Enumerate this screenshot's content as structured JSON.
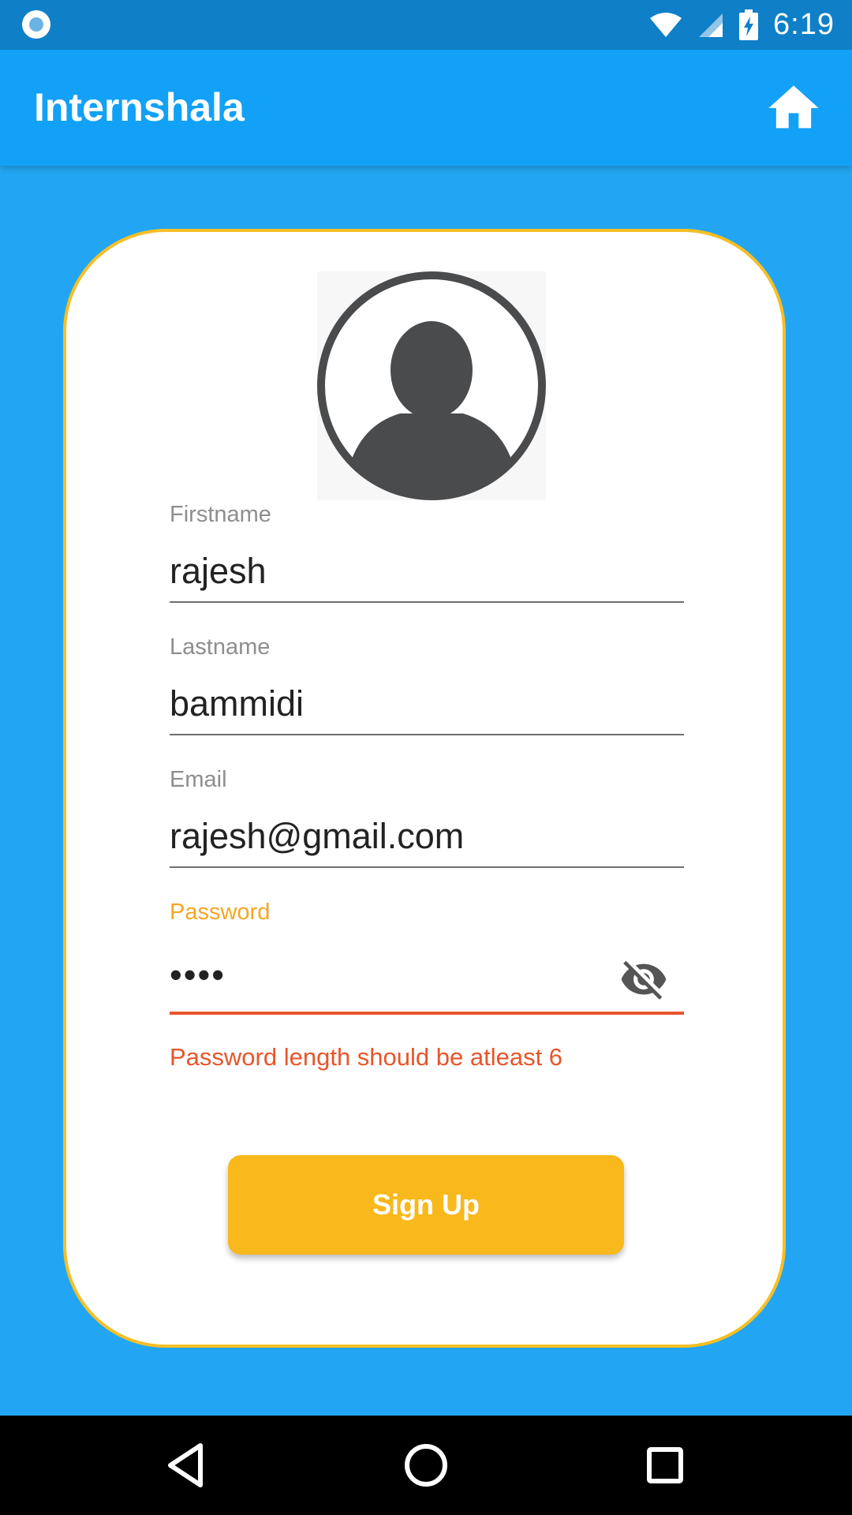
{
  "status_bar": {
    "time": "6:19",
    "left_icon": "notification-dot-icon",
    "icons": [
      "wifi-icon",
      "signal-icon",
      "battery-charging-icon"
    ]
  },
  "app_bar": {
    "title": "Internshala",
    "home_icon": "home-icon"
  },
  "form": {
    "avatar_icon": "user-avatar-icon",
    "firstname": {
      "label": "Firstname",
      "value": "rajesh"
    },
    "lastname": {
      "label": "Lastname",
      "value": "bammidi"
    },
    "email": {
      "label": "Email",
      "value": "rajesh@gmail.com"
    },
    "password": {
      "label": "Password",
      "value": "••••",
      "toggle_icon": "visibility-off-icon",
      "error": "Password length should be atleast 6"
    },
    "signup_label": "Sign Up"
  },
  "nav_bar": {
    "back_icon": "back-triangle-icon",
    "home_icon": "home-circle-icon",
    "recents_icon": "recents-square-icon"
  },
  "colors": {
    "background": "#22a6f3",
    "app_bar": "#12a1f7",
    "status_bar": "#0f7fc8",
    "card_border": "#f6bf26",
    "button": "#f9b81b",
    "error": "#e8552a",
    "focused_label": "#f6a623"
  }
}
